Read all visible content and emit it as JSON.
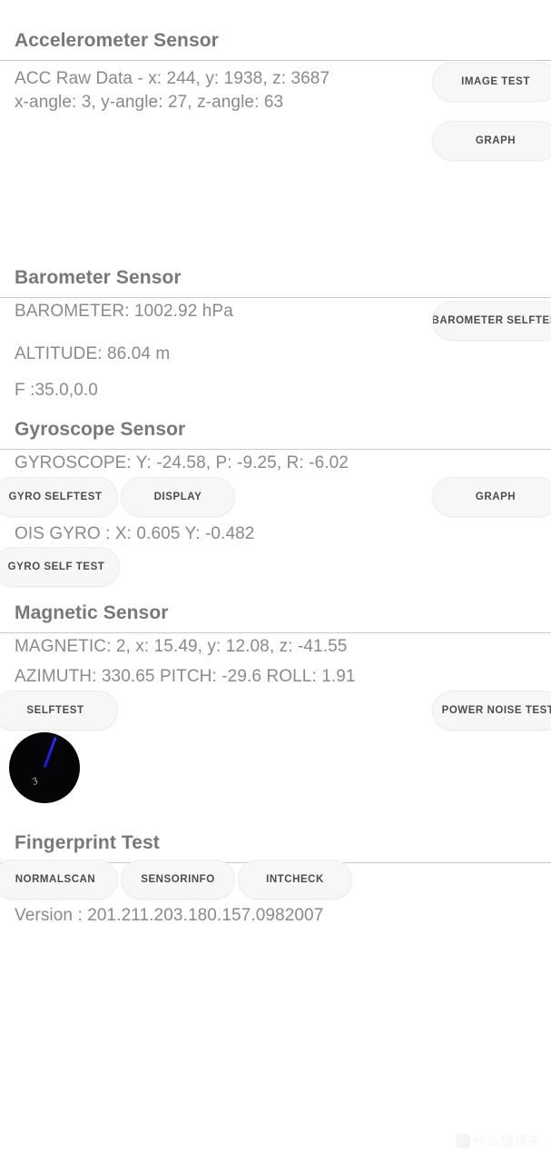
{
  "sections": [
    {
      "id": "accelerometer",
      "title": "Accelerometer Sensor",
      "lines": [
        "ACC Raw Data - x: 244, y: 1938, z: 3687",
        "x-angle: 3, y-angle: 27, z-angle: 63"
      ],
      "buttons": [
        {
          "label": "IMAGE TEST"
        },
        {
          "label": "GRAPH"
        }
      ]
    },
    {
      "id": "barometer",
      "title": "Barometer Sensor",
      "lines": [
        "BAROMETER: 1002.92 hPa",
        "ALTITUDE: 86.04 m",
        "F :35.0,0.0"
      ],
      "buttons": [
        {
          "label": "BAROMETER SELFTEST"
        }
      ]
    },
    {
      "id": "gyroscope",
      "title": "Gyroscope Sensor",
      "lines": [
        "GYROSCOPE: Y: -24.58, P: -9.25, R: -6.02",
        "OIS GYRO : X: 0.605 Y: -0.482"
      ],
      "buttons": [
        {
          "label": "GYRO SELFTEST"
        },
        {
          "label": "DISPLAY"
        },
        {
          "label": "GRAPH"
        },
        {
          "label": "GYRO SELF TEST"
        }
      ]
    },
    {
      "id": "magnetic",
      "title": "Magnetic Sensor",
      "lines": [
        "MAGNETIC: 2, x: 15.49, y: 12.08, z: -41.55",
        "AZIMUTH: 330.65  PITCH: -29.6  ROLL: 1.91"
      ],
      "buttons": [
        {
          "label": "SELFTEST"
        },
        {
          "label": "POWER NOISE TEST"
        }
      ],
      "compass": {
        "label": "3",
        "needle_color": "#2a2aff",
        "dial_color": "#050508"
      }
    },
    {
      "id": "fingerprint",
      "title": "Fingerprint Test",
      "lines": [
        "Version : 201.211.203.180.157.0982007"
      ],
      "buttons": [
        {
          "label": "NORMALSCAN"
        },
        {
          "label": "SENSORINFO"
        },
        {
          "label": "INTCHECK"
        }
      ]
    }
  ],
  "watermark": {
    "text": "什么值得买",
    "icon": "smzdm-logo-icon"
  },
  "colors": {
    "background": "#ffffff",
    "heading": "#787878",
    "body_text": "#8a8a8a",
    "divider": "#c9c9c9",
    "button_fill": "#f7f7f7",
    "button_text": "#4c4c4c",
    "compass_dial": "#050508",
    "compass_needle": "#2a2aff"
  }
}
